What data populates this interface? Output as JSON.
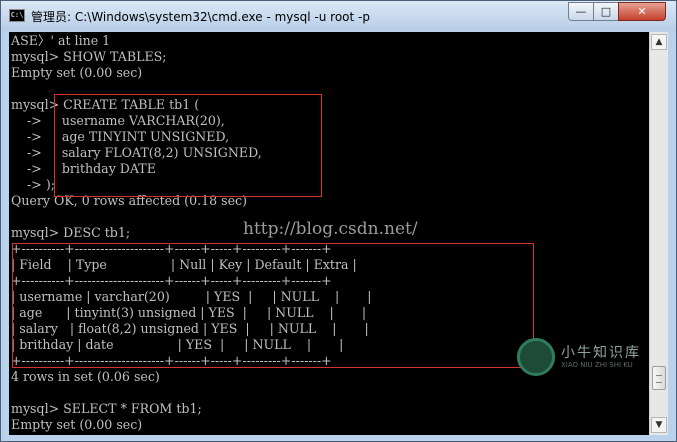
{
  "window": {
    "title": "管理员: C:\\Windows\\system32\\cmd.exe - mysql  -u root -p",
    "icon": "C:\\",
    "controls": {
      "minimize": "—",
      "maximize": "□",
      "close": "✕"
    }
  },
  "console": {
    "lines": [
      "ASE〉' at line 1",
      "mysql> SHOW TABLES;",
      "Empty set (0.00 sec)",
      "",
      "mysql> CREATE TABLE tb1 (",
      "    ->     username VARCHAR(20),",
      "    ->     age TINYINT UNSIGNED,",
      "    ->     salary FLOAT(8,2) UNSIGNED,",
      "    ->     brithday DATE",
      "    -> );",
      "Query OK, 0 rows affected (0.18 sec)",
      "",
      "mysql> DESC tb1;",
      "+----------+---------------------+------+-----+---------+-------+",
      "| Field    | Type                | Null | Key | Default | Extra |",
      "+----------+---------------------+------+-----+---------+-------+",
      "| username | varchar(20)         | YES  |     | NULL    |       |",
      "| age      | tinyint(3) unsigned | YES  |     | NULL    |       |",
      "| salary   | float(8,2) unsigned | YES  |     | NULL    |       |",
      "| brithday | date                | YES  |     | NULL    |       |",
      "+----------+---------------------+------+-----+---------+-------+",
      "4 rows in set (0.06 sec)",
      "",
      "mysql> SELECT * FROM tb1;",
      "Empty set (0.00 sec)"
    ]
  },
  "watermark": "http://blog.csdn.net/",
  "logo": {
    "text": "小牛知识库",
    "subtext": "XIAO NIU ZHI SHI KU"
  },
  "scrollbar": {
    "up": "▲",
    "down": "▼"
  }
}
